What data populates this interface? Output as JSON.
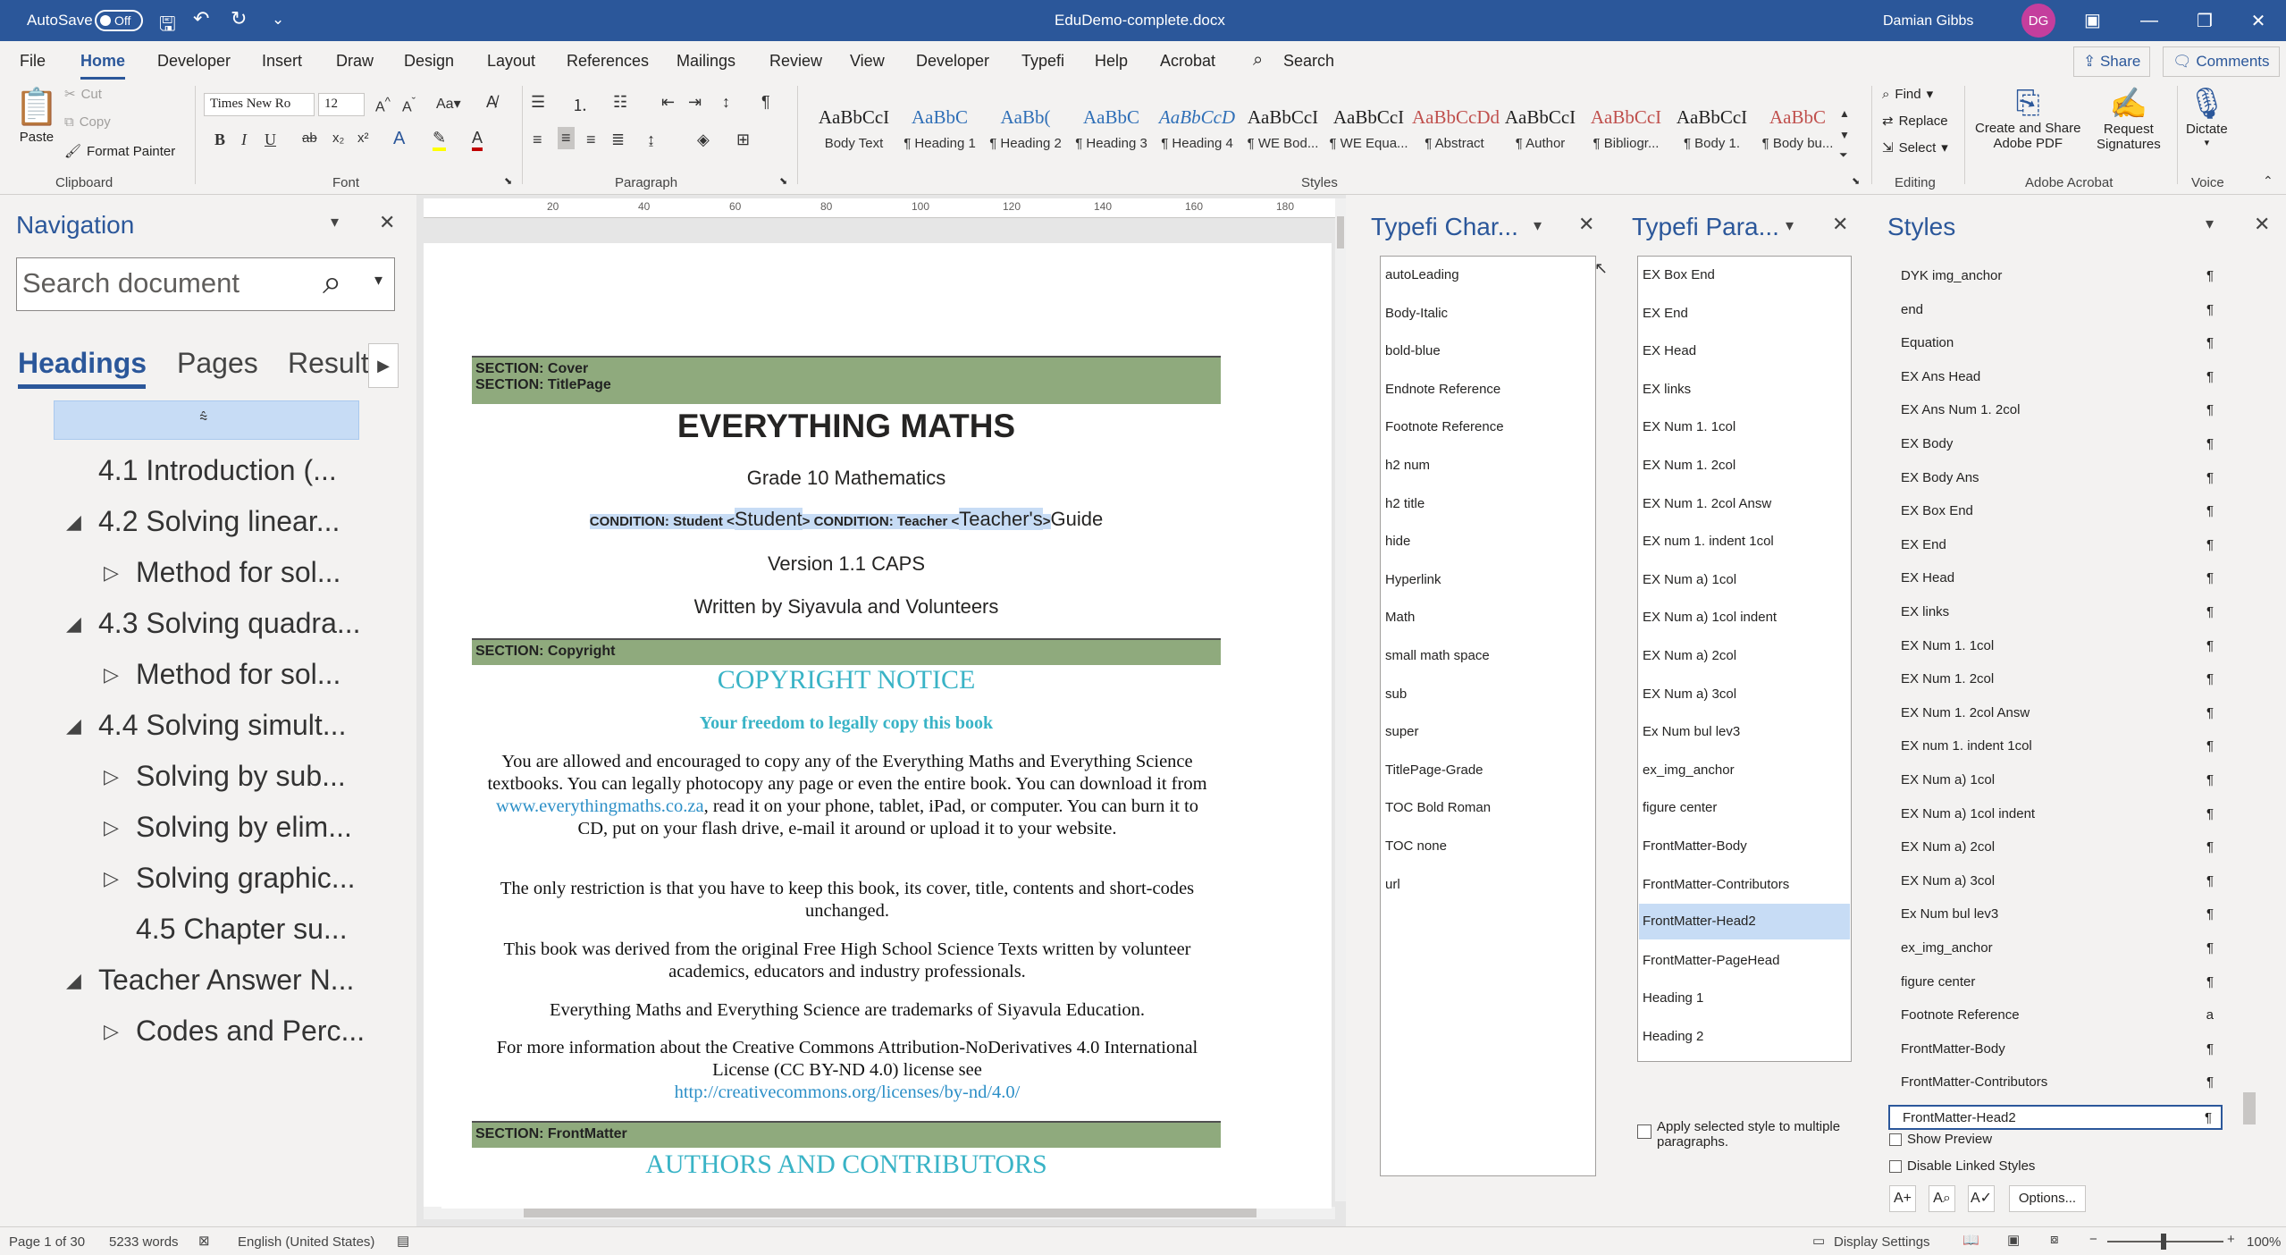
{
  "titlebar": {
    "autosave_label": "AutoSave",
    "autosave_state": "Off",
    "doc_title": "EduDemo-complete.docx",
    "user_name": "Damian Gibbs",
    "user_initials": "DG"
  },
  "menu": {
    "tabs": [
      "File",
      "Home",
      "Developer",
      "Insert",
      "Draw",
      "Design",
      "Layout",
      "References",
      "Mailings",
      "Review",
      "View",
      "Developer",
      "Typefi",
      "Help",
      "Acrobat"
    ],
    "search_label": "Search",
    "share_label": "Share",
    "comments_label": "Comments"
  },
  "ribbon": {
    "clipboard": {
      "paste": "Paste",
      "cut": "Cut",
      "copy": "Copy",
      "format_painter": "Format Painter",
      "label": "Clipboard"
    },
    "font": {
      "name": "Times New Ro",
      "size": "12",
      "label": "Font"
    },
    "paragraph_label": "Paragraph",
    "styles": {
      "label": "Styles",
      "items": [
        {
          "preview": "AaBbCcI",
          "name": "Body Text"
        },
        {
          "preview": "AaBbC",
          "name": "¶ Heading 1"
        },
        {
          "preview": "AaBb(",
          "name": "¶ Heading 2"
        },
        {
          "preview": "AaBbC",
          "name": "¶ Heading 3"
        },
        {
          "preview": "AaBbCcD",
          "name": "¶ Heading 4"
        },
        {
          "preview": "AaBbCcI",
          "name": "¶ WE Bod..."
        },
        {
          "preview": "AaBbCcI",
          "name": "¶ WE Equa..."
        },
        {
          "preview": "AaBbCcDd",
          "name": "¶ Abstract"
        },
        {
          "preview": "AaBbCcI",
          "name": "¶ Author"
        },
        {
          "preview": "AaBbCcI",
          "name": "¶ Bibliogr..."
        },
        {
          "preview": "AaBbCcI",
          "name": "¶ Body 1."
        },
        {
          "preview": "AaBbC",
          "name": "¶ Body bu..."
        }
      ]
    },
    "editing": {
      "find": "Find",
      "replace": "Replace",
      "select": "Select",
      "label": "Editing"
    },
    "acrobat": {
      "create": "Create and Share",
      "create2": "Adobe PDF",
      "request": "Request",
      "request2": "Signatures",
      "label": "Adobe Acrobat"
    },
    "voice": {
      "dictate": "Dictate",
      "label": "Voice"
    }
  },
  "navigation": {
    "title": "Navigation",
    "search_placeholder": "Search document",
    "tabs": [
      "Headings",
      "Pages",
      "Results"
    ],
    "items": [
      {
        "text": "4.1 Introduction  (...",
        "level": 1,
        "arrow": ""
      },
      {
        "text": "4.2 Solving linear...",
        "level": 1,
        "arrow": "◢"
      },
      {
        "text": "Method for sol...",
        "level": 2,
        "arrow": "▷"
      },
      {
        "text": "4.3 Solving quadra...",
        "level": 1,
        "arrow": "◢"
      },
      {
        "text": "Method for sol...",
        "level": 2,
        "arrow": "▷"
      },
      {
        "text": "4.4 Solving simult...",
        "level": 1,
        "arrow": "◢"
      },
      {
        "text": "Solving by sub...",
        "level": 2,
        "arrow": "▷"
      },
      {
        "text": "Solving by elim...",
        "level": 2,
        "arrow": "▷"
      },
      {
        "text": "Solving graphic...",
        "level": 2,
        "arrow": "▷"
      },
      {
        "text": "4.5 Chapter su...",
        "level": 2,
        "arrow": ""
      },
      {
        "text": "Teacher Answer N...",
        "level": 1,
        "arrow": "◢"
      },
      {
        "text": "Codes and Perc...",
        "level": 2,
        "arrow": "▷"
      }
    ]
  },
  "ruler": [
    "20",
    "40",
    "60",
    "80",
    "100",
    "120",
    "140",
    "160",
    "180"
  ],
  "document": {
    "sec_cover": "SECTION: Cover",
    "sec_titlepage": "SECTION: TitlePage",
    "book_title": "EVERYTHING MATHS",
    "grade": "Grade 10 Mathematics",
    "cond1": "CONDITION: Student <",
    "cond_student": "Student",
    "cond2": "> CONDITION: Teacher <",
    "cond_teacher": "Teacher's",
    "cond3": ">",
    "guide": "Guide",
    "version": "Version 1.1 CAPS",
    "written_by": "Written by Siyavula and Volunteers",
    "sec_copyright": "SECTION: Copyright",
    "copyright_title": "COPYRIGHT NOTICE",
    "copyright_sub": "Your freedom to legally copy this book",
    "p1a": "You are allowed and encouraged to copy any of the Everything Maths and Everything Science textbooks. You can legally photocopy any page or even the entire book. You can download it from ",
    "p1_link": "www.everythingmaths.co.za",
    "p1b": ", read it on your phone, tablet, iPad, or computer. You can burn it to CD, put on your flash drive, e-mail it around or upload it to your website.",
    "p2": "The only restriction is that you have to keep this book, its cover, title, contents and short-codes unchanged.",
    "p3": "This book was derived from the original Free High School Science Texts written by volunteer academics, educators and industry professionals.",
    "p4": "Everything Maths and Everything Science are trademarks of Siyavula Education.",
    "p5": "For more information about the Creative Commons Attribution-NoDerivatives 4.0 International License (CC BY-ND 4.0) license see",
    "p5_link": "http://creativecommons.org/licenses/by-nd/4.0/",
    "sec_frontmatter": "SECTION: FrontMatter",
    "authors_title": "AUTHORS AND CONTRIBUTORS"
  },
  "typefi_char": {
    "title": "Typefi Char...",
    "items": [
      "autoLeading",
      "Body-Italic",
      "bold-blue",
      "Endnote Reference",
      "Footnote Reference",
      "h2 num",
      "h2 title",
      "hide",
      "Hyperlink",
      "Math",
      "small math space",
      "sub",
      "super",
      "TitlePage-Grade",
      "TOC Bold Roman",
      "TOC none",
      "url"
    ]
  },
  "typefi_para": {
    "title": "Typefi Para...",
    "items": [
      "EX Box End",
      "EX End",
      "EX Head",
      "EX links",
      "EX Num 1. 1col",
      "EX Num 1. 2col",
      "EX Num 1. 2col Answ",
      "EX num 1. indent 1col",
      "EX Num a) 1col",
      "EX Num a) 1col indent",
      "EX Num a) 2col",
      "EX Num a) 3col",
      "Ex Num bul lev3",
      "ex_img_anchor",
      "figure center",
      "FrontMatter-Body",
      "FrontMatter-Contributors",
      "FrontMatter-Head2",
      "FrontMatter-PageHead",
      "Heading 1",
      "Heading 2"
    ],
    "selected": "FrontMatter-Head2",
    "apply_multi": "Apply selected style to multiple paragraphs."
  },
  "styles_pane": {
    "title": "Styles",
    "items": [
      {
        "name": "DYK img_anchor",
        "mark": "¶"
      },
      {
        "name": "end",
        "mark": "¶"
      },
      {
        "name": "Equation",
        "mark": "¶"
      },
      {
        "name": "EX Ans Head",
        "mark": "¶"
      },
      {
        "name": "EX Ans Num 1. 2col",
        "mark": "¶"
      },
      {
        "name": "EX Body",
        "mark": "¶"
      },
      {
        "name": "EX Body Ans",
        "mark": "¶"
      },
      {
        "name": "EX Box End",
        "mark": "¶"
      },
      {
        "name": "EX End",
        "mark": "¶"
      },
      {
        "name": "EX Head",
        "mark": "¶"
      },
      {
        "name": "EX links",
        "mark": "¶"
      },
      {
        "name": "EX Num 1. 1col",
        "mark": "¶"
      },
      {
        "name": "EX Num 1. 2col",
        "mark": "¶"
      },
      {
        "name": "EX Num 1. 2col Answ",
        "mark": "¶"
      },
      {
        "name": "EX num 1. indent 1col",
        "mark": "¶"
      },
      {
        "name": "EX Num a) 1col",
        "mark": "¶"
      },
      {
        "name": "EX Num a) 1col indent",
        "mark": "¶"
      },
      {
        "name": "EX Num a) 2col",
        "mark": "¶"
      },
      {
        "name": "EX Num a) 3col",
        "mark": "¶"
      },
      {
        "name": "Ex Num bul lev3",
        "mark": "¶"
      },
      {
        "name": "ex_img_anchor",
        "mark": "¶"
      },
      {
        "name": "figure center",
        "mark": "¶"
      },
      {
        "name": "Footnote Reference",
        "mark": "a"
      },
      {
        "name": "FrontMatter-Body",
        "mark": "¶"
      },
      {
        "name": "FrontMatter-Contributors",
        "mark": "¶"
      },
      {
        "name": "FrontMatter-Head2",
        "mark": "¶"
      }
    ],
    "selected": "FrontMatter-Head2",
    "show_preview": "Show Preview",
    "disable_linked": "Disable Linked Styles",
    "options": "Options..."
  },
  "status": {
    "page": "Page 1 of 30",
    "words": "5233 words",
    "language": "English (United States)",
    "display_settings": "Display Settings",
    "zoom": "100%"
  },
  "colors": {
    "accent": "#2b579a",
    "section_bar": "#8faa7d",
    "teal_heading": "#39b3c6"
  }
}
